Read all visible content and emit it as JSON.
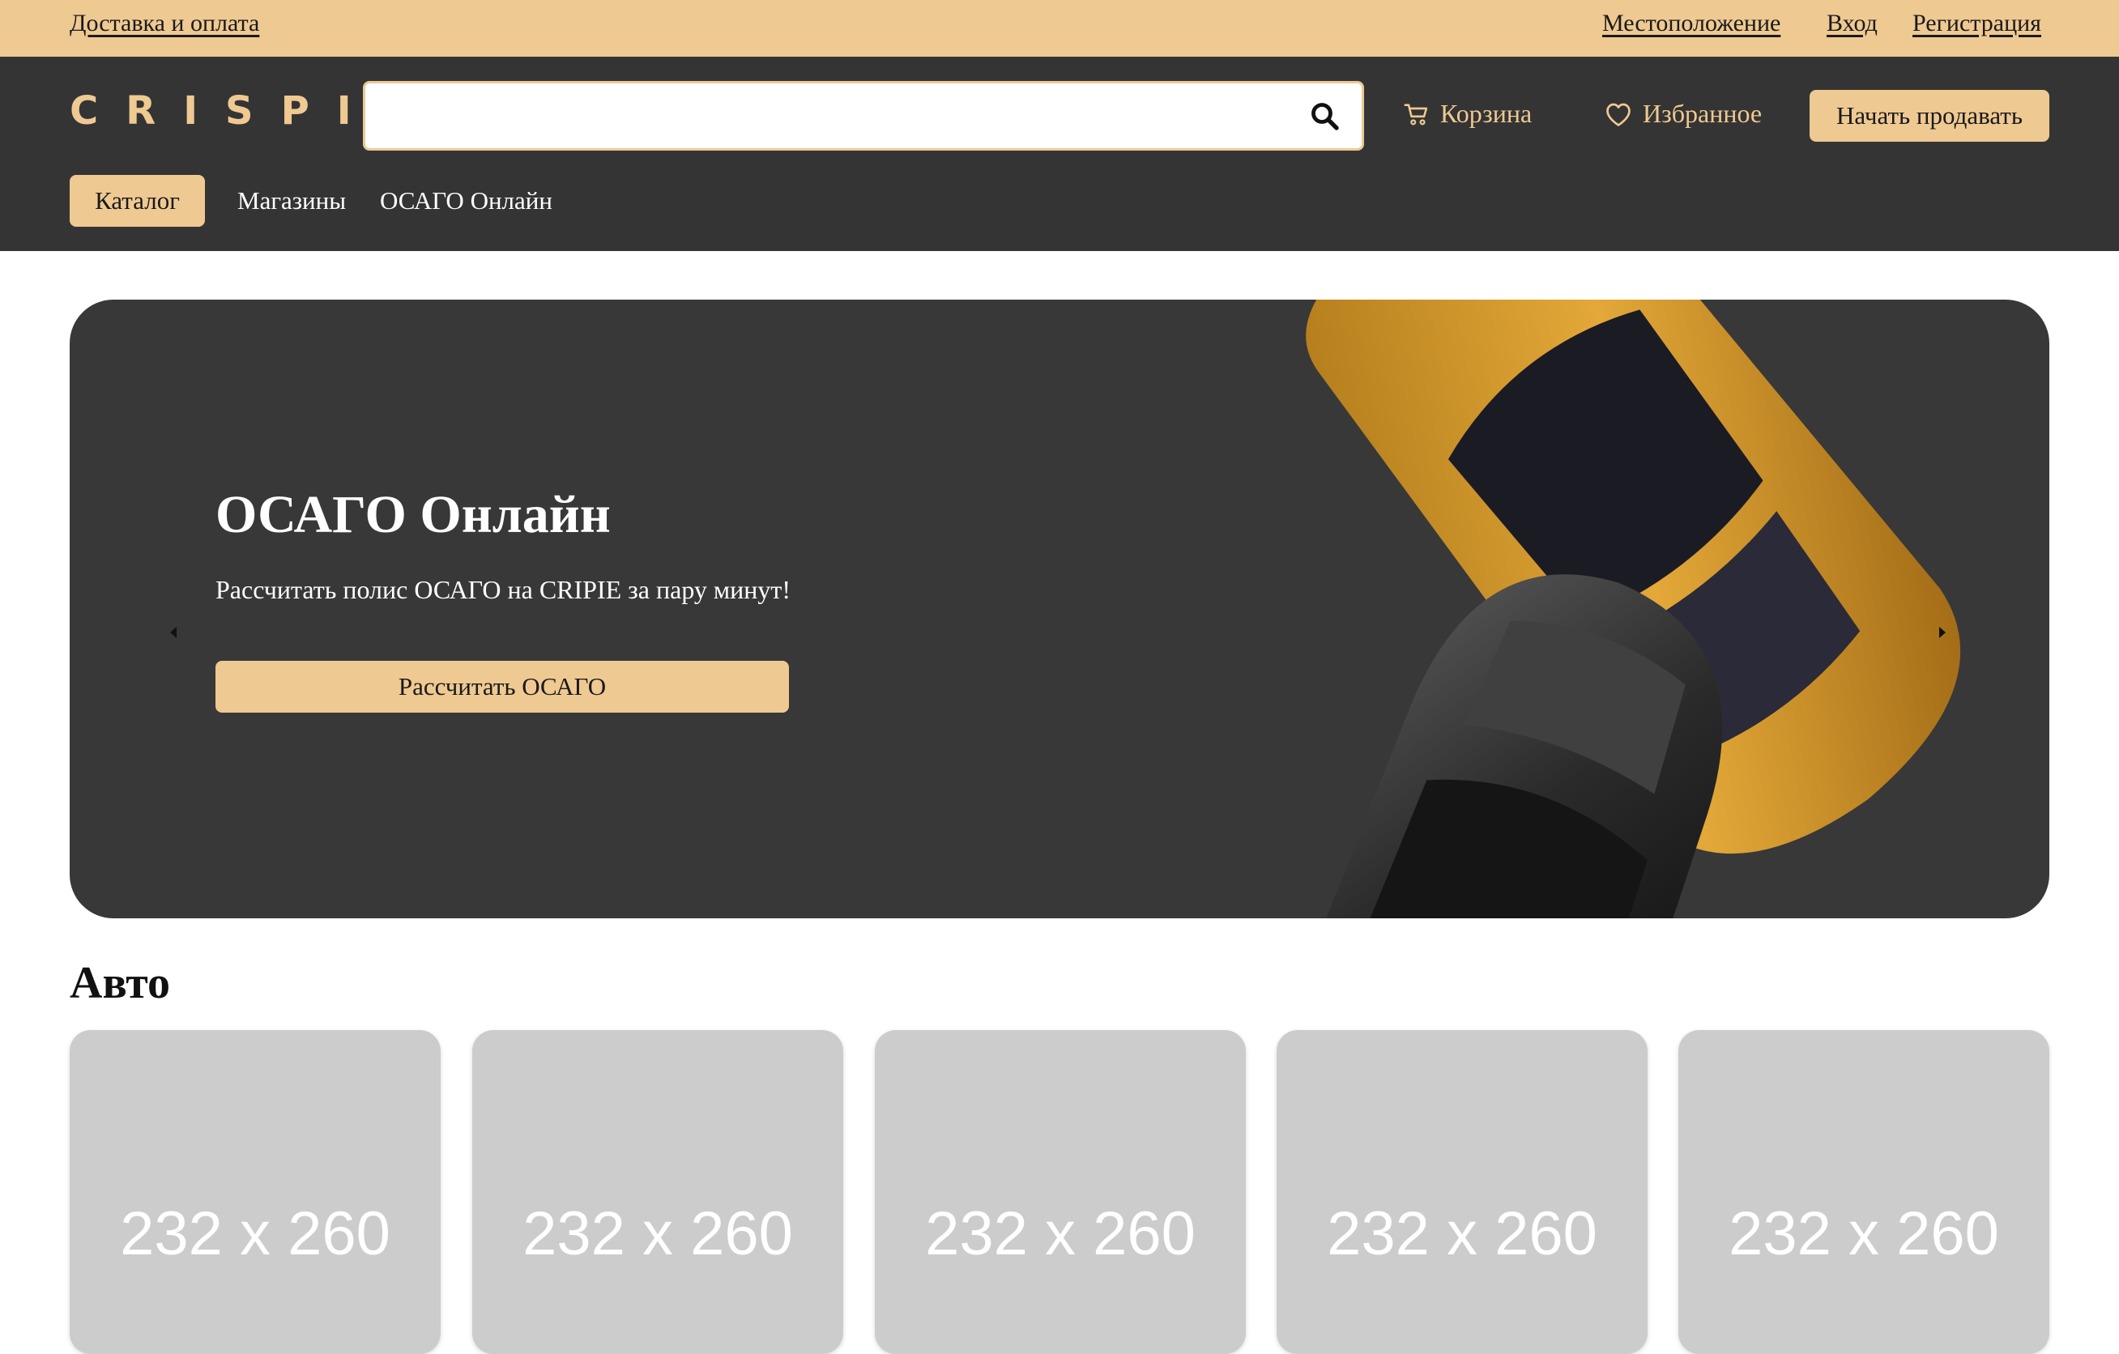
{
  "topbar": {
    "delivery": "Доставка и оплата",
    "location": "Местоположение",
    "login": "Вход",
    "register": "Регистрация"
  },
  "header": {
    "logo": "CRISPIE",
    "search_placeholder": "",
    "cart": "Корзина",
    "favorites": "Избранное",
    "sell": "Начать продавать"
  },
  "nav": {
    "catalog": "Каталог",
    "shops": "Магазины",
    "osago": "ОСАГО Онлайн"
  },
  "banner": {
    "title": "ОСАГО Онлайн",
    "subtitle": "Рассчитать полис ОСАГО на CRIPIE за пару минут!",
    "button": "Рассчитать ОСАГО"
  },
  "section": {
    "title": "Авто",
    "cards": [
      "232 x 260",
      "232 x 260",
      "232 x 260",
      "232 x 260",
      "232 x 260"
    ]
  },
  "colors": {
    "accent": "#efc992",
    "header_bg": "#343434",
    "banner_bg": "#383838",
    "placeholder": "#cccccc"
  },
  "icons": [
    "search-icon",
    "cart-icon",
    "heart-icon",
    "arrow-left-icon",
    "arrow-right-icon"
  ]
}
